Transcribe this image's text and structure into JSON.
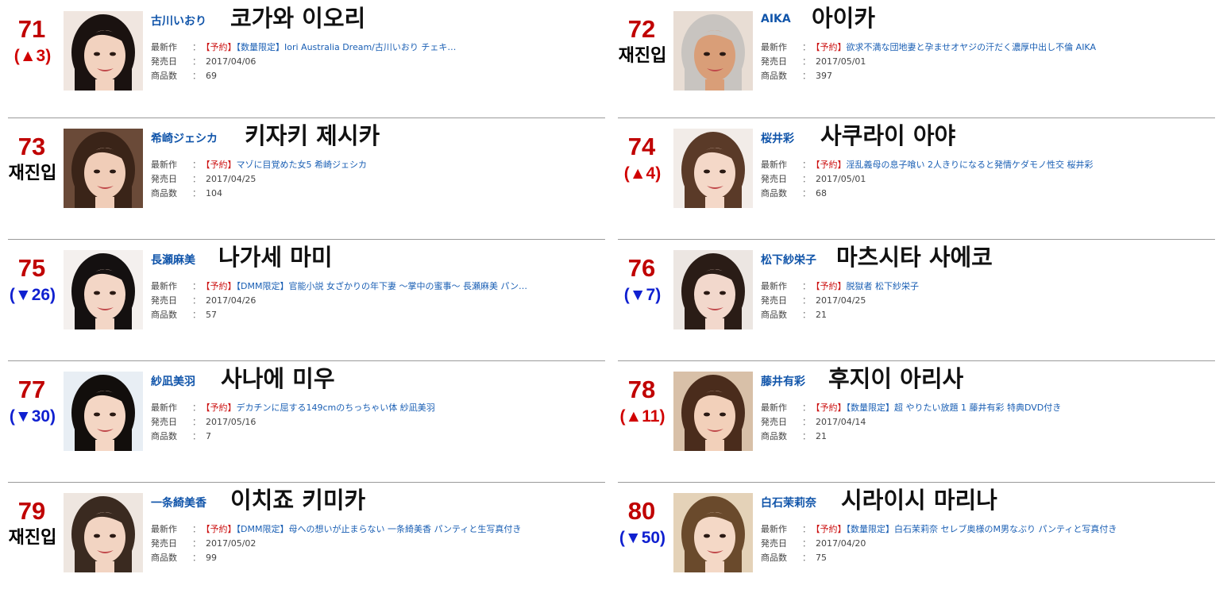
{
  "labels": {
    "latest_work": "最新作",
    "release_date": "発売日",
    "item_count": "商品数",
    "colon": "："
  },
  "colors": {
    "rank_number": "#c00000",
    "rank_up": "#d00000",
    "rank_down": "#1020d0",
    "jp_name_link": "#1155aa",
    "reservation_tag": "#cc1111",
    "work_link": "#1a5fb4"
  },
  "entries": [
    {
      "rank": "71",
      "change": "(▲3)",
      "change_kind": "up",
      "jp_name": "古川いおり",
      "kr_name": "코가와 이오리",
      "tag": "【予約】",
      "work": "【数量限定】Iori Australia Dream/古川いおり チェキ…",
      "date": "2017/04/06",
      "count": "69",
      "photo": {
        "hair": "#1a1210",
        "skin": "#f2d2bf",
        "bg": "#f0e6e0"
      }
    },
    {
      "rank": "72",
      "change": "재진입",
      "change_kind": "re",
      "jp_name": "AIKA",
      "kr_name": "아이카",
      "tag": "【予約】",
      "work": "欲求不満な団地妻と孕ませオヤジの汗だく濃厚中出し不倫 AIKA",
      "date": "2017/05/01",
      "count": "397",
      "photo": {
        "hair": "#c8c4c0",
        "skin": "#d99e78",
        "bg": "#e8ddd4"
      }
    },
    {
      "rank": "73",
      "change": "재진입",
      "change_kind": "re",
      "jp_name": "希崎ジェシカ",
      "kr_name": "키자키 제시카",
      "tag": "【予約】",
      "work": "マゾに目覚めた女5 希崎ジェシカ",
      "date": "2017/04/25",
      "count": "104",
      "photo": {
        "hair": "#3a2418",
        "skin": "#f0cdb8",
        "bg": "#6a4a38"
      }
    },
    {
      "rank": "74",
      "change": "(▲4)",
      "change_kind": "up",
      "jp_name": "桜井彩",
      "kr_name": "사쿠라이 아야",
      "tag": "【予約】",
      "work": "淫乱義母の息子喰い 2人きりになると発情ケダモノ性交 桜井彩",
      "date": "2017/05/01",
      "count": "68",
      "photo": {
        "hair": "#5a3a28",
        "skin": "#f4d8c8",
        "bg": "#f2ece8"
      }
    },
    {
      "rank": "75",
      "change": "(▼26)",
      "change_kind": "down",
      "jp_name": "長瀬麻美",
      "kr_name": "나가세 마미",
      "tag": "【予約】",
      "work": "【DMM限定】官能小説 女ざかりの年下妻 ～掌中の蜜事～ 長瀬麻美 パン…",
      "date": "2017/04/26",
      "count": "57",
      "photo": {
        "hair": "#141010",
        "skin": "#f3d6c6",
        "bg": "#f4f0ee"
      }
    },
    {
      "rank": "76",
      "change": "(▼7)",
      "change_kind": "down",
      "jp_name": "松下紗栄子",
      "kr_name": "마츠시타 사에코",
      "tag": "【予約】",
      "work": "脱獄者 松下紗栄子",
      "date": "2017/04/25",
      "count": "21",
      "photo": {
        "hair": "#2a1c16",
        "skin": "#f2d8cc",
        "bg": "#ece6e2"
      }
    },
    {
      "rank": "77",
      "change": "(▼30)",
      "change_kind": "down",
      "jp_name": "紗凪美羽",
      "kr_name": "사나에 미우",
      "tag": "【予約】",
      "work": "デカチンに屈する149cmのちっちゃい体 紗凪美羽",
      "date": "2017/05/16",
      "count": "7",
      "photo": {
        "hair": "#120e0c",
        "skin": "#f4d6c4",
        "bg": "#e8eef4"
      }
    },
    {
      "rank": "78",
      "change": "(▲11)",
      "change_kind": "up",
      "jp_name": "藤井有彩",
      "kr_name": "후지이 아리사",
      "tag": "【予約】",
      "work": "【数量限定】超 やりたい放題 1 藤井有彩 特典DVD付き",
      "date": "2017/04/14",
      "count": "21",
      "photo": {
        "hair": "#4a2c1c",
        "skin": "#f2d0ba",
        "bg": "#d8c0a8"
      }
    },
    {
      "rank": "79",
      "change": "재진입",
      "change_kind": "re",
      "jp_name": "一条綺美香",
      "kr_name": "이치죠 키미카",
      "tag": "【予約】",
      "work": "【DMM限定】母への想いが止まらない 一条綺美香 パンティと生写真付き",
      "date": "2017/05/02",
      "count": "99",
      "photo": {
        "hair": "#3a2a20",
        "skin": "#f2d4c2",
        "bg": "#eee6e0"
      }
    },
    {
      "rank": "80",
      "change": "(▼50)",
      "change_kind": "down",
      "jp_name": "白石茉莉奈",
      "kr_name": "시라이시 마리나",
      "tag": "【予約】",
      "work": "【数量限定】白石茉莉奈 セレブ奥様のM男なぶり パンティと写真付き",
      "date": "2017/04/20",
      "count": "75",
      "photo": {
        "hair": "#6a4a2c",
        "skin": "#f4d8c6",
        "bg": "#e4d2b8"
      }
    }
  ]
}
